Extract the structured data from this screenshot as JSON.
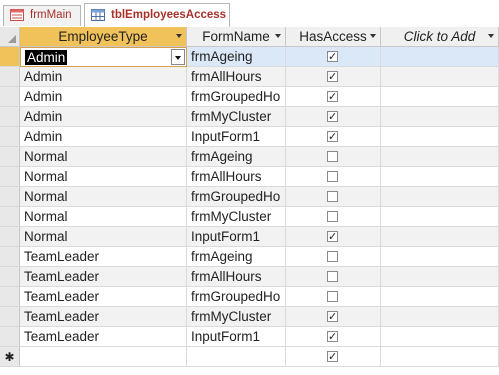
{
  "tabs": [
    {
      "label": "frmMain",
      "icon": "form-icon"
    },
    {
      "label": "tblEmployeesAccess",
      "icon": "table-icon"
    }
  ],
  "columns": [
    {
      "label": "EmployeeType",
      "sortable": true
    },
    {
      "label": "FormName",
      "sortable": true
    },
    {
      "label": "HasAccess",
      "sortable": true
    },
    {
      "label": "Click to Add",
      "sortable": true
    }
  ],
  "rows": [
    {
      "type": "Admin",
      "form": "frmAgeing",
      "access": true
    },
    {
      "type": "Admin",
      "form": "frmAllHours",
      "access": true
    },
    {
      "type": "Admin",
      "form": "frmGroupedHo",
      "access": true
    },
    {
      "type": "Admin",
      "form": "frmMyCluster",
      "access": true
    },
    {
      "type": "Admin",
      "form": "InputForm1",
      "access": true
    },
    {
      "type": "Normal",
      "form": "frmAgeing",
      "access": false
    },
    {
      "type": "Normal",
      "form": "frmAllHours",
      "access": false
    },
    {
      "type": "Normal",
      "form": "frmGroupedHo",
      "access": false
    },
    {
      "type": "Normal",
      "form": "frmMyCluster",
      "access": false
    },
    {
      "type": "Normal",
      "form": "InputForm1",
      "access": true
    },
    {
      "type": "TeamLeader",
      "form": "frmAgeing",
      "access": false
    },
    {
      "type": "TeamLeader",
      "form": "frmAllHours",
      "access": false
    },
    {
      "type": "TeamLeader",
      "form": "frmGroupedHo",
      "access": false
    },
    {
      "type": "TeamLeader",
      "form": "frmMyCluster",
      "access": true
    },
    {
      "type": "TeamLeader",
      "form": "InputForm1",
      "access": true
    }
  ],
  "new_row": {
    "marker": "✱",
    "access": true
  },
  "colors": {
    "active_header": "#f2c25a",
    "selected_row": "#dbe8f7",
    "tab_text": "#a8312a"
  }
}
